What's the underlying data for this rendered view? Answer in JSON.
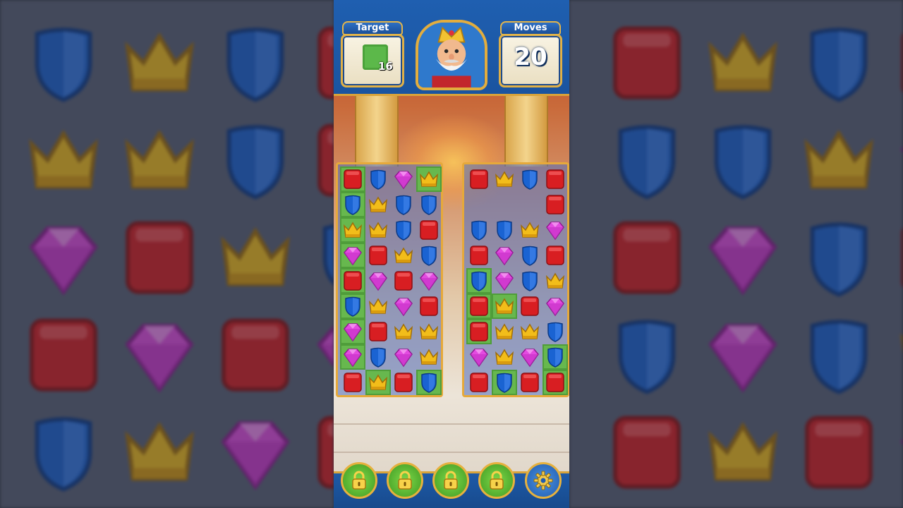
{
  "header": {
    "target_label": "Target",
    "target_count": "16",
    "moves_label": "Moves",
    "moves_count": "20"
  },
  "icons": {
    "target_icon": "grass-tile-icon",
    "avatar": "king-avatar",
    "bottom_buttons": [
      "lock-icon",
      "lock-icon",
      "lock-icon",
      "lock-icon",
      "gear-icon"
    ]
  },
  "colors": {
    "red_block": "#d81e22",
    "blue_shield": "#1a63d2",
    "pink_gem": "#e34be0",
    "yellow_crown": "#f2bd1a",
    "grass": "#67b84e",
    "frame_gold": "#e6a93a",
    "header_blue": "#1f5fb0"
  },
  "boards": {
    "left": [
      [
        "R",
        "B",
        "P",
        "Y"
      ],
      [
        "B",
        "Y",
        "B",
        "B"
      ],
      [
        "Y",
        "Y",
        "B",
        "R"
      ],
      [
        "P",
        "R",
        "Y",
        "B"
      ],
      [
        "R",
        "P",
        "R",
        "P"
      ],
      [
        "B",
        "Y",
        "P",
        "R"
      ],
      [
        "P",
        "R",
        "Y",
        "Y"
      ],
      [
        "P",
        "B",
        "P",
        "Y"
      ],
      [
        "R",
        "Y",
        "R",
        "B"
      ]
    ],
    "right": [
      [
        "R",
        "Y",
        "B",
        "R"
      ],
      [
        "",
        "",
        "",
        "R"
      ],
      [
        "B",
        "B",
        "Y",
        "P"
      ],
      [
        "R",
        "P",
        "B",
        "R"
      ],
      [
        "B",
        "P",
        "B",
        "Y"
      ],
      [
        "R",
        "Y",
        "R",
        "P"
      ],
      [
        "R",
        "Y",
        "Y",
        "B"
      ],
      [
        "P",
        "Y",
        "P",
        "B"
      ],
      [
        "R",
        "B",
        "R",
        "R"
      ]
    ],
    "left_grass": [
      "0-0",
      "0-3",
      "1-0",
      "3-0",
      "4-0",
      "5-0",
      "6-0",
      "7-0",
      "8-1",
      "8-3",
      "2-0"
    ],
    "right_grass": [
      "4-0",
      "5-0",
      "6-0",
      "5-1",
      "7-3",
      "8-3",
      "8-1"
    ]
  }
}
